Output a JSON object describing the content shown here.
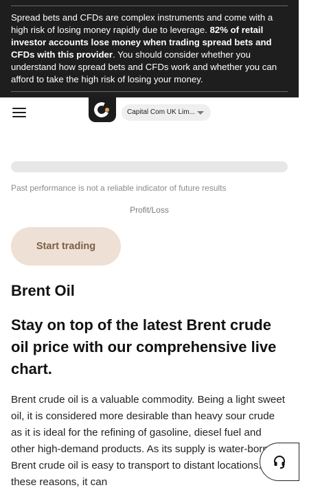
{
  "risk_banner": {
    "part1": "Spread bets and CFDs are complex instruments and come with a high risk of losing money rapidly due to leverage. ",
    "bold": "82% of retail investor accounts lose money when trading spread bets and CFDs with this provider",
    "part2": ". You should consider whether you understand how spread bets and CFDs work and whether you can afford to take the high risk of losing your money."
  },
  "header": {
    "entity_selector": "Capital Com UK Lim..."
  },
  "main": {
    "disclaimer": "Past performance is not a reliable indicator of future results",
    "profit_loss_label": "Profit/Loss",
    "cta_label": "Start trading",
    "title": "Brent Oil",
    "subtitle": "Stay on top of the latest Brent crude oil price with our comprehensive live chart.",
    "body": "Brent crude oil is a valuable commodity. Being a light sweet oil, it is considered more desirable than heavy sour crude as it is ideal for the refining of gasoline, diesel fuel and other high-demand products. As its supply is water-borne, Brent crude oil is easy to transport to distant locations. For these reasons, it can"
  },
  "icons": {
    "menu": "hamburger-menu-icon",
    "logo": "capital-com-logo",
    "dropdown": "caret-down-icon",
    "support": "headset-icon"
  },
  "colors": {
    "banner_bg": "#1e1e1e",
    "cta_bg": "#eee0d4",
    "cta_text": "#7a5f46",
    "logo_accent": "#e0a96a"
  }
}
